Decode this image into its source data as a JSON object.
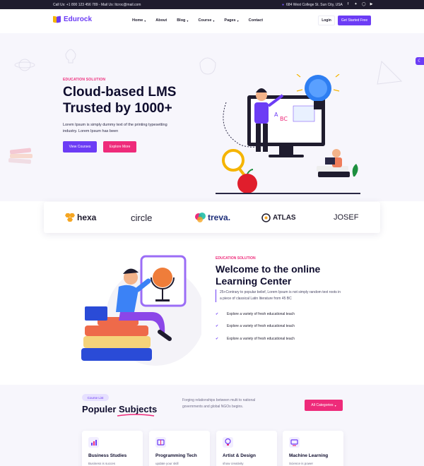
{
  "topbar": {
    "contact": "Call Us: +1 800 123 456 789 - Mail Us: ltcroc@mail.com",
    "address": "684 West College St. Sun City, USA",
    "socials": [
      "facebook-icon",
      "twitter-icon",
      "instagram-icon",
      "youtube-icon"
    ]
  },
  "nav": {
    "logo": "Edurock",
    "menu": [
      {
        "label": "Home",
        "has_dropdown": true
      },
      {
        "label": "About",
        "has_dropdown": false
      },
      {
        "label": "Blog",
        "has_dropdown": true
      },
      {
        "label": "Course",
        "has_dropdown": true
      },
      {
        "label": "Pages",
        "has_dropdown": true
      },
      {
        "label": "Contact",
        "has_dropdown": false
      }
    ],
    "login": "Login",
    "get_started": "Get Started Free"
  },
  "hero": {
    "eyebrow": "EDUCATION SOLUTION",
    "title_line1": "Cloud-based LMS",
    "title_line2": "Trusted by 1000+",
    "description": "Lorem Ipsum is simply dummy text of the printing typesetting industry. Lorem Ipsum has been",
    "btn_primary": "View Courses",
    "btn_secondary": "Explore More"
  },
  "brands": [
    "hexa",
    "circle",
    "treva.",
    "ATLAS",
    "JOSEF"
  ],
  "welcome": {
    "eyebrow": "EDUCATION SOLUTION",
    "title_line1": "Welcome to the online",
    "title_line2": "Learning Center",
    "description": "25+Contrary to popular belief, Lorem Ipsum is not simply random text roots in a piece of classical Latin literature from 45 BC",
    "checklist": [
      "Explore a variety of fresh educational teach",
      "Explore a variety of fresh educational teach",
      "Explore a variety of fresh educational teach"
    ]
  },
  "subjects": {
    "pill": "Course List",
    "title_plain": "Populer ",
    "title_accent": "Subjects",
    "description": "Forging relationships between multi to national governments and global NGOs begins.",
    "btn_all": "All Categories",
    "cards": [
      {
        "title": "Business Studies",
        "subtitle": "Business is succes",
        "icon": "chart-icon"
      },
      {
        "title": "Programming Tech",
        "subtitle": "update your skill",
        "icon": "book-icon"
      },
      {
        "title": "Artist & Design",
        "subtitle": "show creativity",
        "icon": "bulb-icon"
      },
      {
        "title": "Machine Learning",
        "subtitle": "Science is power",
        "icon": "monitor-icon"
      }
    ]
  },
  "colors": {
    "primary": "#6c3cf5",
    "accent": "#ee2b7a",
    "dark": "#1f1c2e",
    "hero_bg": "#f7f6fc"
  }
}
